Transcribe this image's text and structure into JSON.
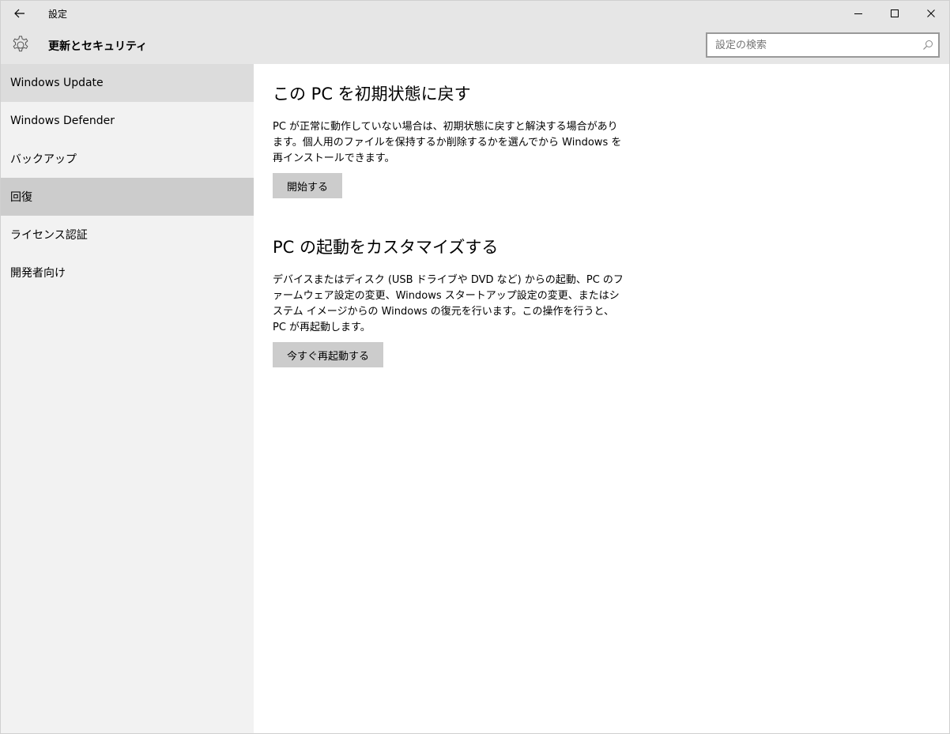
{
  "window": {
    "title": "設定"
  },
  "header": {
    "title": "更新とセキュリティ",
    "search_placeholder": "設定の検索"
  },
  "sidebar": {
    "items": [
      {
        "label": "Windows Update"
      },
      {
        "label": "Windows Defender"
      },
      {
        "label": "バックアップ"
      },
      {
        "label": "回復"
      },
      {
        "label": "ライセンス認証"
      },
      {
        "label": "開発者向け"
      }
    ],
    "selected_index": 3
  },
  "main": {
    "reset": {
      "title": "この PC を初期状態に戻す",
      "body": "PC が正常に動作していない場合は、初期状態に戻すと解決する場合があります。個人用のファイルを保持するか削除するかを選んでから Windows を再インストールできます。",
      "button": "開始する"
    },
    "advanced": {
      "title": "PC の起動をカスタマイズする",
      "body": "デバイスまたはディスク (USB ドライブや DVD など) からの起動、PC のファームウェア設定の変更、Windows スタートアップ設定の変更、またはシステム イメージからの Windows の復元を行います。この操作を行うと、PC が再起動します。",
      "button": "今すぐ再起動する"
    }
  },
  "colors": {
    "chrome": "#e6e6e6",
    "sidebar": "#f2f2f2",
    "selected": "#cccccc",
    "button": "#cccccc"
  }
}
